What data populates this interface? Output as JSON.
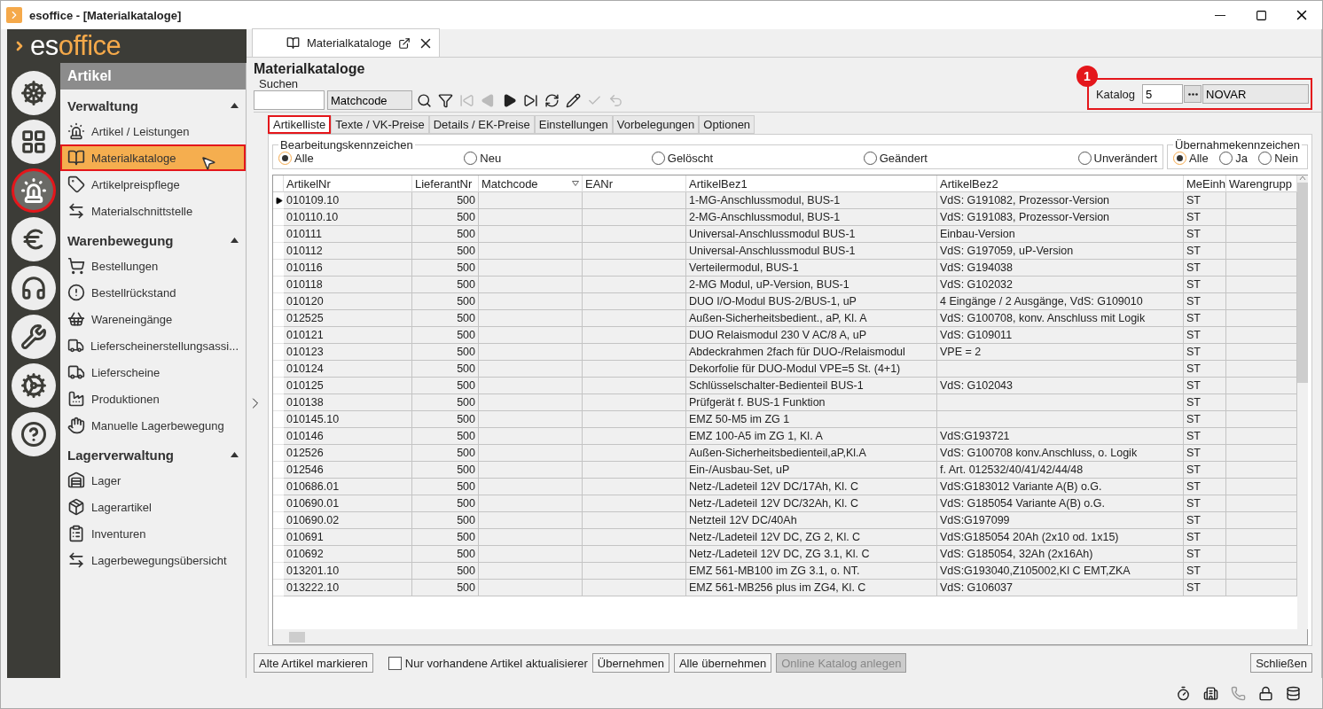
{
  "window": {
    "title": "esoffice - [Materialkataloge]"
  },
  "logo": [
    "es",
    "office"
  ],
  "rail": [
    {
      "kind": "wheel",
      "selected": false
    },
    {
      "kind": "planner",
      "selected": false
    },
    {
      "kind": "siren",
      "selected": true
    },
    {
      "kind": "euro",
      "selected": false
    },
    {
      "kind": "headset",
      "selected": false
    },
    {
      "kind": "tools",
      "selected": false
    },
    {
      "kind": "gears",
      "selected": false
    },
    {
      "kind": "help",
      "selected": false
    }
  ],
  "nav": {
    "header": "Artikel",
    "sections": [
      {
        "title": "Verwaltung",
        "expanded": true,
        "items": [
          {
            "label": "Artikel / Leistungen",
            "selected": false
          },
          {
            "label": "Materialkataloge",
            "selected": true
          },
          {
            "label": "Artikelpreispflege",
            "selected": false
          },
          {
            "label": "Materialschnittstelle",
            "selected": false
          }
        ]
      },
      {
        "title": "Warenbewegung",
        "expanded": true,
        "items": [
          {
            "label": "Bestellungen",
            "selected": false
          },
          {
            "label": "Bestellrückstand",
            "selected": false
          },
          {
            "label": "Wareneingänge",
            "selected": false
          },
          {
            "label": "Lieferscheinerstellungsassi...",
            "selected": false
          },
          {
            "label": "Lieferscheine",
            "selected": false
          },
          {
            "label": "Produktionen",
            "selected": false
          },
          {
            "label": "Manuelle Lagerbewegung",
            "selected": false
          }
        ]
      },
      {
        "title": "Lagerverwaltung",
        "expanded": true,
        "items": [
          {
            "label": "Lager",
            "selected": false
          },
          {
            "label": "Lagerartikel",
            "selected": false
          },
          {
            "label": "Inventuren",
            "selected": false
          },
          {
            "label": "Lagerbewegungsübersicht",
            "selected": false
          }
        ]
      }
    ]
  },
  "doc_tab": {
    "label": "Materialkataloge"
  },
  "page_title": "Materialkataloge",
  "search": {
    "label": "Suchen",
    "matchcode": "Matchcode"
  },
  "toolbar": [
    {
      "kind": "search",
      "disabled": false
    },
    {
      "kind": "filter",
      "disabled": false
    },
    {
      "kind": "first",
      "disabled": true
    },
    {
      "kind": "prev",
      "disabled": true
    },
    {
      "kind": "next",
      "disabled": false
    },
    {
      "kind": "last",
      "disabled": false
    },
    {
      "kind": "refresh",
      "disabled": false
    },
    {
      "kind": "edit",
      "disabled": false
    },
    {
      "kind": "save",
      "disabled": true
    },
    {
      "kind": "undo",
      "disabled": true
    }
  ],
  "katalog": {
    "badge": "1",
    "label": "Katalog",
    "value": "5",
    "name": "NOVAR",
    "highlighted": true
  },
  "tabs": [
    {
      "label": "Artikelliste",
      "selected": true
    },
    {
      "label": "Texte / VK-Preise",
      "selected": false
    },
    {
      "label": "Details / EK-Preise",
      "selected": false
    },
    {
      "label": "Einstellungen",
      "selected": false
    },
    {
      "label": "Vorbelegungen",
      "selected": false
    },
    {
      "label": "Optionen",
      "selected": false
    }
  ],
  "bearbeitungskennzeichen": {
    "title": "Bearbeitungskennzeichen",
    "options": [
      {
        "label": "Alle",
        "selected": true
      },
      {
        "label": "Neu",
        "selected": false
      },
      {
        "label": "Gelöscht",
        "selected": false
      },
      {
        "label": "Geändert",
        "selected": false
      },
      {
        "label": "Unverändert",
        "selected": false
      }
    ]
  },
  "uebernahmekennzeichen": {
    "title": "Übernahmekennzeichen",
    "options": [
      {
        "label": "Alle",
        "selected": true
      },
      {
        "label": "Ja",
        "selected": false
      },
      {
        "label": "Nein",
        "selected": false
      }
    ]
  },
  "table": {
    "columns": [
      "ArtikelNr",
      "LieferantNr",
      "Matchcode",
      "EANr",
      "ArtikelBez1",
      "ArtikelBez2",
      "MeEinh",
      "Warengrupp"
    ],
    "rows": [
      {
        "current": true,
        "artikel_nr": "010109.10",
        "lieferant_nr": "500",
        "artikel_bez1": "1-MG-Anschlussmodul, BUS-1",
        "artikel_bez2": "VdS: G191082, Prozessor-Version",
        "me_einh": "ST"
      },
      {
        "current": false,
        "artikel_nr": "010110.10",
        "lieferant_nr": "500",
        "artikel_bez1": "2-MG-Anschlussmodul, BUS-1",
        "artikel_bez2": "VdS: G191083, Prozessor-Version",
        "me_einh": "ST"
      },
      {
        "current": false,
        "artikel_nr": "010111",
        "lieferant_nr": "500",
        "artikel_bez1": "Universal-Anschlussmodul BUS-1",
        "artikel_bez2": "Einbau-Version",
        "me_einh": "ST"
      },
      {
        "current": false,
        "artikel_nr": "010112",
        "lieferant_nr": "500",
        "artikel_bez1": "Universal-Anschlussmodul BUS-1",
        "artikel_bez2": "VdS: G197059, uP-Version",
        "me_einh": "ST"
      },
      {
        "current": false,
        "artikel_nr": "010116",
        "lieferant_nr": "500",
        "artikel_bez1": "Verteilermodul,  BUS-1",
        "artikel_bez2": "VdS: G194038",
        "me_einh": "ST"
      },
      {
        "current": false,
        "artikel_nr": "010118",
        "lieferant_nr": "500",
        "artikel_bez1": "2-MG Modul, uP-Version, BUS-1",
        "artikel_bez2": "VdS: G102032",
        "me_einh": "ST"
      },
      {
        "current": false,
        "artikel_nr": "010120",
        "lieferant_nr": "500",
        "artikel_bez1": "DUO I/O-Modul BUS-2/BUS-1, uP",
        "artikel_bez2": "4 Eingänge / 2 Ausgänge, VdS: G109010",
        "me_einh": "ST"
      },
      {
        "current": false,
        "artikel_nr": "012525",
        "lieferant_nr": "500",
        "artikel_bez1": "Außen-Sicherheitsbedient., aP, Kl. A",
        "artikel_bez2": "VdS: G100708, konv. Anschluss mit Logik",
        "me_einh": "ST"
      },
      {
        "current": false,
        "artikel_nr": "010121",
        "lieferant_nr": "500",
        "artikel_bez1": "DUO Relaismodul 230 V AC/8 A, uP",
        "artikel_bez2": "VdS: G109011",
        "me_einh": "ST"
      },
      {
        "current": false,
        "artikel_nr": "010123",
        "lieferant_nr": "500",
        "artikel_bez1": "Abdeckrahmen 2fach für DUO-/Relaismodul",
        "artikel_bez2": "VPE = 2",
        "me_einh": "ST"
      },
      {
        "current": false,
        "artikel_nr": "010124",
        "lieferant_nr": "500",
        "artikel_bez1": "Dekorfolie für DUO-Modul VPE=5 St. (4+1)",
        "me_einh": "ST"
      },
      {
        "current": false,
        "artikel_nr": "010125",
        "lieferant_nr": "500",
        "artikel_bez1": "Schlüsselschalter-Bedienteil BUS-1",
        "artikel_bez2": "VdS: G102043",
        "me_einh": "ST"
      },
      {
        "current": false,
        "artikel_nr": "010138",
        "lieferant_nr": "500",
        "artikel_bez1": "Prüfgerät f. BUS-1 Funktion",
        "me_einh": "ST"
      },
      {
        "current": false,
        "artikel_nr": "010145.10",
        "lieferant_nr": "500",
        "artikel_bez1": "EMZ 50-M5 im ZG 1",
        "me_einh": "ST"
      },
      {
        "current": false,
        "artikel_nr": "010146",
        "lieferant_nr": "500",
        "artikel_bez1": "EMZ 100-A5 im ZG 1, Kl. A",
        "artikel_bez2": "VdS:G193721",
        "me_einh": "ST"
      },
      {
        "current": false,
        "artikel_nr": "012526",
        "lieferant_nr": "500",
        "artikel_bez1": "Außen-Sicherheitsbedienteil,aP,Kl.A",
        "artikel_bez2": "VdS: G100708 konv.Anschluss, o. Logik",
        "me_einh": "ST"
      },
      {
        "current": false,
        "artikel_nr": "012546",
        "lieferant_nr": "500",
        "artikel_bez1": "Ein-/Ausbau-Set, uP",
        "artikel_bez2": "f. Art. 012532/40/41/42/44/48",
        "me_einh": "ST"
      },
      {
        "current": false,
        "artikel_nr": "010686.01",
        "lieferant_nr": "500",
        "artikel_bez1": "Netz-/Ladeteil 12V DC/17Ah, Kl. C",
        "artikel_bez2": "VdS:G183012   Variante A(B) o.G.",
        "me_einh": "ST"
      },
      {
        "current": false,
        "artikel_nr": "010690.01",
        "lieferant_nr": "500",
        "artikel_bez1": "Netz-/Ladeteil 12V DC/32Ah, Kl. C",
        "artikel_bez2": "VdS: G185054  Variante A(B) o.G.",
        "me_einh": "ST"
      },
      {
        "current": false,
        "artikel_nr": "010690.02",
        "lieferant_nr": "500",
        "artikel_bez1": "Netzteil 12V DC/40Ah",
        "artikel_bez2": "VdS:G197099",
        "me_einh": "ST"
      },
      {
        "current": false,
        "artikel_nr": "010691",
        "lieferant_nr": "500",
        "artikel_bez1": "Netz-/Ladeteil 12V DC,  ZG 2, Kl. C",
        "artikel_bez2": "VdS:G185054  20Ah (2x10 od. 1x15)",
        "me_einh": "ST"
      },
      {
        "current": false,
        "artikel_nr": "010692",
        "lieferant_nr": "500",
        "artikel_bez1": "Netz-/Ladeteil 12V DC, ZG 3.1, Kl. C",
        "artikel_bez2": "VdS: G185054, 32Ah (2x16Ah)",
        "me_einh": "ST"
      },
      {
        "current": false,
        "artikel_nr": "013201.10",
        "lieferant_nr": "500",
        "artikel_bez1": "EMZ 561-MB100  im ZG 3.1, o. NT.",
        "artikel_bez2": "VdS:G193040,Z105002,Kl C EMT,ZKA",
        "me_einh": "ST"
      },
      {
        "current": false,
        "artikel_nr": "013222.10",
        "lieferant_nr": "500",
        "artikel_bez1": "EMZ 561-MB256 plus im ZG4, Kl. C",
        "artikel_bez2": "VdS: G106037",
        "me_einh": "ST"
      }
    ]
  },
  "actions": [
    {
      "kind": "button",
      "label": "Alte Artikel markieren",
      "disabled": false
    },
    {
      "kind": "checkbox",
      "label": "Nur vorhandene Artikel aktualisierer",
      "checked": false
    },
    {
      "kind": "button",
      "label": "Übernehmen",
      "disabled": false
    },
    {
      "kind": "button",
      "label": "Alle übernehmen",
      "disabled": false
    },
    {
      "kind": "button",
      "label": "Online Katalog anlegen",
      "disabled": true
    },
    {
      "kind": "spacer"
    },
    {
      "kind": "button",
      "label": "Schließen",
      "disabled": false
    }
  ]
}
